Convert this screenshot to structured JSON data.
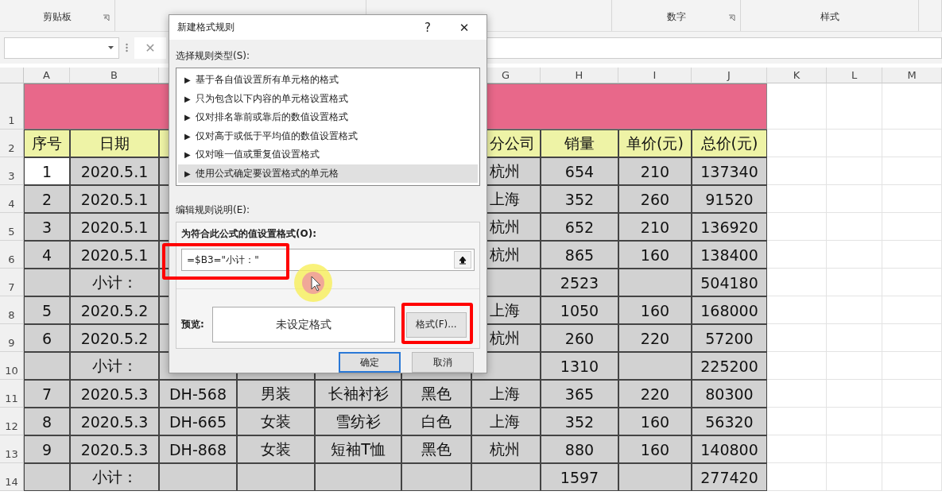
{
  "ribbon": {
    "groups": [
      {
        "label": "剪贴板",
        "launcher": true
      },
      {
        "label": "数字",
        "launcher": true
      },
      {
        "label": "样式"
      }
    ]
  },
  "formula_bar": {
    "cancel": "✕"
  },
  "sheet": {
    "columns": [
      "A",
      "B",
      null,
      null,
      null,
      null,
      "G",
      "H",
      "I",
      "J",
      "K",
      "L",
      "M"
    ],
    "rows": [
      {
        "number": "1",
        "kind": "title"
      },
      {
        "number": "2",
        "kind": "header",
        "cells": {
          "A": "序号",
          "B": "日期",
          "G": "分公司",
          "H": "销量",
          "I": "单价(元)",
          "J": "总价(元)"
        }
      },
      {
        "number": "3",
        "kind": "data",
        "cells": {
          "A": {
            "text": "1",
            "active": true
          },
          "B": "2020.5.1",
          "G": "杭州",
          "H": "654",
          "I": "210",
          "J": "137340"
        }
      },
      {
        "number": "4",
        "kind": "data",
        "cells": {
          "A": "2",
          "B": "2020.5.1",
          "G": "上海",
          "H": "352",
          "I": "260",
          "J": "91520"
        }
      },
      {
        "number": "5",
        "kind": "data",
        "cells": {
          "A": "3",
          "B": "2020.5.1",
          "G": "杭州",
          "H": "652",
          "I": "210",
          "J": "136920"
        }
      },
      {
        "number": "6",
        "kind": "data",
        "cells": {
          "A": "4",
          "B": "2020.5.1",
          "G": "杭州",
          "H": "865",
          "I": "160",
          "J": "138400"
        }
      },
      {
        "number": "7",
        "kind": "data",
        "cells": {
          "B": "小计：",
          "H": "2523",
          "J": "504180"
        }
      },
      {
        "number": "8",
        "kind": "data",
        "cells": {
          "A": "5",
          "B": "2020.5.2",
          "G": "上海",
          "H": "1050",
          "I": "160",
          "J": "168000"
        }
      },
      {
        "number": "9",
        "kind": "data",
        "cells": {
          "A": "6",
          "B": "2020.5.2",
          "G": "杭州",
          "H": "260",
          "I": "220",
          "J": "57200"
        }
      },
      {
        "number": "10",
        "kind": "data",
        "cells": {
          "B": "小计：",
          "H": "1310",
          "J": "225200"
        }
      },
      {
        "number": "11",
        "kind": "data",
        "cells": {
          "A": "7",
          "B": "2020.5.3",
          "C": "DH-568",
          "D": "男装",
          "E": "长袖衬衫",
          "F": "黑色",
          "G": "上海",
          "H": "365",
          "I": "220",
          "J": "80300"
        }
      },
      {
        "number": "12",
        "kind": "data",
        "cells": {
          "A": "8",
          "B": "2020.5.3",
          "C": "DH-665",
          "D": "女装",
          "E": "雪纺衫",
          "F": "白色",
          "G": "上海",
          "H": "352",
          "I": "160",
          "J": "56320"
        }
      },
      {
        "number": "13",
        "kind": "data",
        "cells": {
          "A": "9",
          "B": "2020.5.3",
          "C": "DH-868",
          "D": "女装",
          "E": "短袖T恤",
          "F": "黑色",
          "G": "杭州",
          "H": "880",
          "I": "160",
          "J": "140800"
        }
      },
      {
        "number": "14",
        "kind": "data",
        "cells": {
          "B": "小计：",
          "H": "1597",
          "J": "277420"
        }
      }
    ]
  },
  "dialog": {
    "title": "新建格式规则",
    "help": "?",
    "close": "✕",
    "rule_type_label": "选择规则类型(S):",
    "rule_types": [
      {
        "label": "基于各自值设置所有单元格的格式",
        "selected": false
      },
      {
        "label": "只为包含以下内容的单元格设置格式",
        "selected": false
      },
      {
        "label": "仅对排名靠前或靠后的数值设置格式",
        "selected": false
      },
      {
        "label": "仅对高于或低于平均值的数值设置格式",
        "selected": false
      },
      {
        "label": "仅对唯一值或重复值设置格式",
        "selected": false
      },
      {
        "label": "使用公式确定要设置格式的单元格",
        "selected": true
      }
    ],
    "rule_marker": "▶",
    "edit_label": "编辑规则说明(E):",
    "formula_label": "为符合此公式的值设置格式(O):",
    "formula": {
      "value": "=$B3=\"小计：\""
    },
    "preview_label": "预览:",
    "preview_text": "未设定格式",
    "format_button": "格式(F)...",
    "ok": "确定",
    "cancel": "取消"
  }
}
